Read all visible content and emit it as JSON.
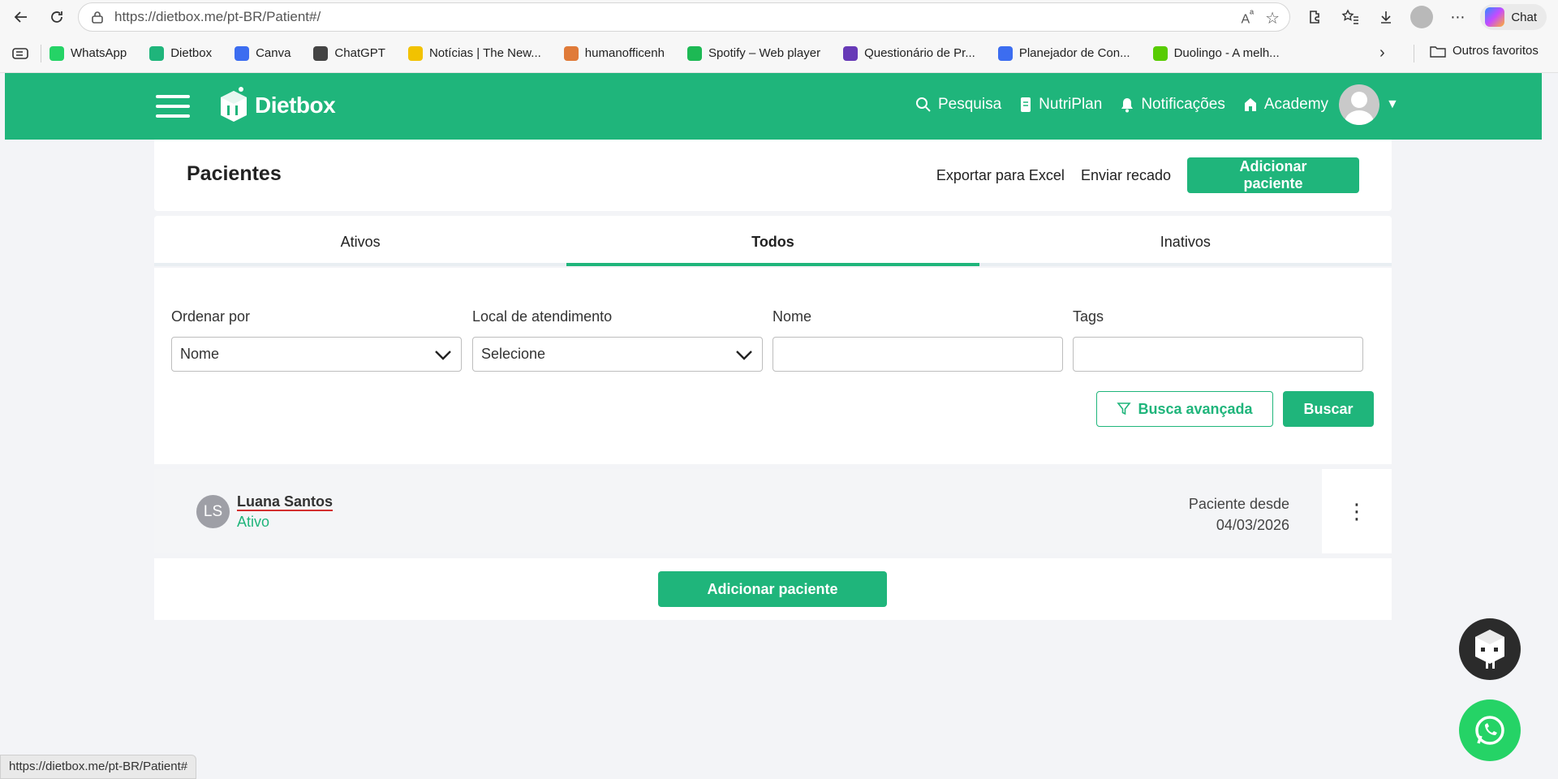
{
  "browser": {
    "url": "https://dietbox.me/pt-BR/Patient#/",
    "copilot_label": "Chat",
    "status_url": "https://dietbox.me/pt-BR/Patient#"
  },
  "bookmarks": {
    "items": [
      {
        "label": "WhatsApp",
        "icon": "whatsapp-icon",
        "color": "#25d366"
      },
      {
        "label": "Dietbox",
        "icon": "dietbox-icon",
        "color": "#1fb57b"
      },
      {
        "label": "Canva",
        "icon": "canva-icon",
        "color": "#3c6df0"
      },
      {
        "label": "ChatGPT",
        "icon": "chatgpt-icon",
        "color": "#444444"
      },
      {
        "label": "Notícias | The New...",
        "icon": "news-icon",
        "color": "#f2c200"
      },
      {
        "label": "humanofficenh",
        "icon": "share-icon",
        "color": "#e07b39"
      },
      {
        "label": "Spotify – Web player",
        "icon": "spotify-icon",
        "color": "#1db954"
      },
      {
        "label": "Questionário de Pr...",
        "icon": "forms-icon",
        "color": "#673ab7"
      },
      {
        "label": "Planejador de Con...",
        "icon": "canva-icon",
        "color": "#3c6df0"
      },
      {
        "label": "Duolingo - A melh...",
        "icon": "duolingo-icon",
        "color": "#58cc02"
      }
    ],
    "other_label": "Outros favoritos"
  },
  "header": {
    "brand": "Dietbox",
    "nav": [
      {
        "label": "Pesquisa",
        "icon": "search-icon"
      },
      {
        "label": "NutriPlan",
        "icon": "document-icon"
      },
      {
        "label": "Notificações",
        "icon": "bell-icon"
      },
      {
        "label": "Academy",
        "icon": "academy-icon"
      }
    ],
    "accent": "#1fb57b"
  },
  "page": {
    "title": "Pacientes",
    "export_label": "Exportar para Excel",
    "message_label": "Enviar recado",
    "add_label": "Adicionar paciente"
  },
  "tabs": [
    {
      "label": "Ativos",
      "active": false
    },
    {
      "label": "Todos",
      "active": true
    },
    {
      "label": "Inativos",
      "active": false
    }
  ],
  "filters": {
    "order_label": "Ordenar por",
    "order_value": "Nome",
    "location_label": "Local de atendimento",
    "location_value": "Selecione",
    "name_label": "Nome",
    "name_value": "",
    "tags_label": "Tags",
    "tags_value": "",
    "advanced_label": "Busca avançada",
    "search_label": "Buscar"
  },
  "patients": [
    {
      "initials": "LS",
      "name": "Luana Santos",
      "status": "Ativo",
      "since_label": "Paciente desde",
      "since_date": "04/03/2026"
    }
  ],
  "footer": {
    "add_label": "Adicionar paciente"
  }
}
